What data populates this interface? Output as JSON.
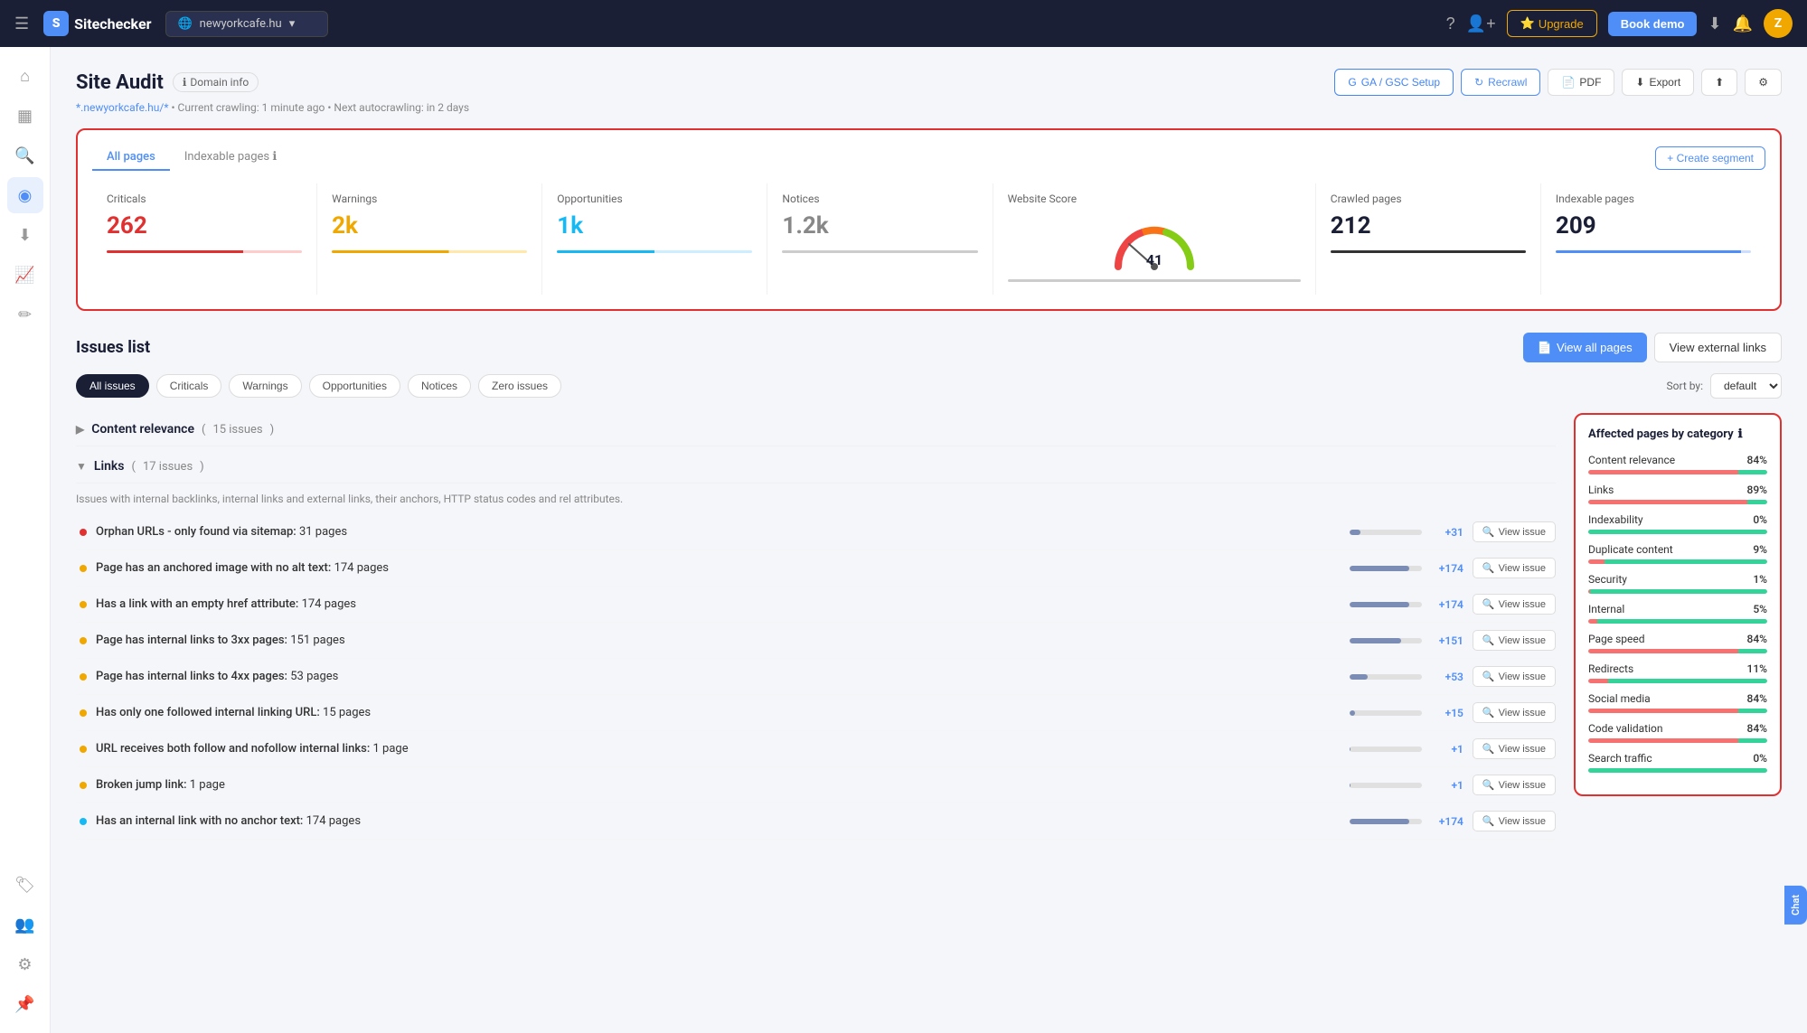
{
  "topnav": {
    "hamburger": "☰",
    "logo_text": "Sitechecker",
    "domain": "newyorkcafe.hu",
    "dropdown_icon": "▾",
    "help_icon": "?",
    "add_user_icon": "👤",
    "upgrade_label": "Upgrade",
    "bookdemo_label": "Book demo",
    "download_icon": "⬇",
    "bell_icon": "🔔",
    "avatar_label": "Z"
  },
  "sidebar": {
    "items": [
      {
        "icon": "⌂",
        "name": "home",
        "active": false
      },
      {
        "icon": "▦",
        "name": "dashboard",
        "active": false
      },
      {
        "icon": "🔍",
        "name": "search",
        "active": false
      },
      {
        "icon": "◎",
        "name": "audit",
        "active": true
      },
      {
        "icon": "⬇",
        "name": "download",
        "active": false
      },
      {
        "icon": "📈",
        "name": "analytics",
        "active": false
      },
      {
        "icon": "✏",
        "name": "edit",
        "active": false
      },
      {
        "icon": "🏷",
        "name": "tags",
        "active": false
      },
      {
        "icon": "👥",
        "name": "users",
        "active": false
      },
      {
        "icon": "⚙",
        "name": "settings",
        "active": false
      }
    ],
    "bottom_item": {
      "icon": "📌",
      "name": "pin"
    }
  },
  "page": {
    "title": "Site Audit",
    "domain_info": "Domain info",
    "subtitle_link": "*.newyorkcafe.hu/*",
    "subtitle": "Current crawling: 1 minute ago  •  Next autocrawling: in 2 days",
    "buttons": {
      "ga_gsc": "GA / GSC Setup",
      "recrawl": "Recrawl",
      "pdf": "PDF",
      "export": "Export"
    }
  },
  "stats": {
    "tab_all": "All pages",
    "tab_indexable": "Indexable pages",
    "create_segment": "+ Create segment",
    "cards": [
      {
        "label": "Criticals",
        "value": "262",
        "type": "critical"
      },
      {
        "label": "Warnings",
        "value": "2k",
        "type": "warning"
      },
      {
        "label": "Opportunities",
        "value": "1k",
        "type": "opportunity"
      },
      {
        "label": "Notices",
        "value": "1.2k",
        "type": "notice"
      },
      {
        "label": "Website Score",
        "value": "41",
        "type": "gauge"
      },
      {
        "label": "Crawled pages",
        "value": "212",
        "type": "crawled"
      },
      {
        "label": "Indexable pages",
        "value": "209",
        "type": "indexable"
      }
    ]
  },
  "issues": {
    "title": "Issues list",
    "view_all_pages": "View all pages",
    "view_external": "View external links",
    "filters": [
      "All issues",
      "Criticals",
      "Warnings",
      "Opportunities",
      "Notices",
      "Zero issues"
    ],
    "active_filter": "All issues",
    "sort_label": "Sort by:",
    "sort_value": "default",
    "categories": [
      {
        "name": "Content relevance",
        "count": "15 issues",
        "collapsed": true
      },
      {
        "name": "Links",
        "count": "17 issues",
        "collapsed": false,
        "description": "Issues with internal backlinks, internal links and external links, their anchors, HTTP status codes and rel attributes.",
        "rows": [
          {
            "indicator": "critical",
            "text": "Orphan URLs - only found via sitemap:",
            "pages": "31 pages",
            "bar_pct": 15,
            "count": "+31",
            "bar_color": "#c0c8d8"
          },
          {
            "indicator": "warning",
            "text": "Page has an anchored image with no alt text:",
            "pages": "174 pages",
            "bar_pct": 82,
            "count": "+174",
            "bar_color": "#c0c8d8"
          },
          {
            "indicator": "warning",
            "text": "Has a link with an empty href attribute:",
            "pages": "174 pages",
            "bar_pct": 82,
            "count": "+174",
            "bar_color": "#c0c8d8"
          },
          {
            "indicator": "warning",
            "text": "Page has internal links to 3xx pages:",
            "pages": "151 pages",
            "bar_pct": 71,
            "count": "+151",
            "bar_color": "#c0c8d8"
          },
          {
            "indicator": "warning",
            "text": "Page has internal links to 4xx pages:",
            "pages": "53 pages",
            "bar_pct": 25,
            "count": "+53",
            "bar_color": "#c0c8d8"
          },
          {
            "indicator": "warning",
            "text": "Has only one followed internal linking URL:",
            "pages": "15 pages",
            "bar_pct": 7,
            "count": "+15",
            "bar_color": "#c0c8d8"
          },
          {
            "indicator": "warning",
            "text": "URL receives both follow and nofollow internal links:",
            "pages": "1 page",
            "bar_pct": 1,
            "count": "+1",
            "bar_color": "#c0c8d8"
          },
          {
            "indicator": "warning",
            "text": "Broken jump link:",
            "pages": "1 page",
            "bar_pct": 1,
            "count": "+1",
            "bar_color": "#c0c8d8"
          },
          {
            "indicator": "notice",
            "text": "Has an internal link with no anchor text:",
            "pages": "174 pages",
            "bar_pct": 82,
            "count": "+174",
            "bar_color": "#c0c8d8"
          }
        ]
      }
    ],
    "view_issue_label": "View issue"
  },
  "affected": {
    "title": "Affected pages by category",
    "rows": [
      {
        "name": "Content relevance",
        "pct": "84%",
        "pct_val": 84
      },
      {
        "name": "Links",
        "pct": "89%",
        "pct_val": 89
      },
      {
        "name": "Indexability",
        "pct": "0%",
        "pct_val": 0
      },
      {
        "name": "Duplicate content",
        "pct": "9%",
        "pct_val": 9
      },
      {
        "name": "Security",
        "pct": "1%",
        "pct_val": 1
      },
      {
        "name": "Internal",
        "pct": "5%",
        "pct_val": 5
      },
      {
        "name": "Page speed",
        "pct": "84%",
        "pct_val": 84
      },
      {
        "name": "Redirects",
        "pct": "11%",
        "pct_val": 11
      },
      {
        "name": "Social media",
        "pct": "84%",
        "pct_val": 84
      },
      {
        "name": "Code validation",
        "pct": "84%",
        "pct_val": 84
      },
      {
        "name": "Search traffic",
        "pct": "0%",
        "pct_val": 0
      }
    ]
  },
  "chat": {
    "label": "Chat"
  }
}
